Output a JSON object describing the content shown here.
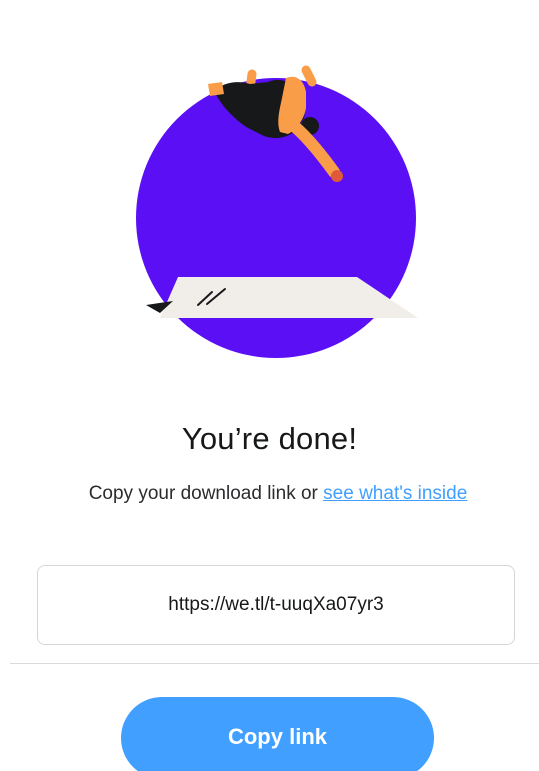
{
  "illustration": {
    "name": "person-jumping-illustration",
    "colors": {
      "circle": "#5b0ff5",
      "skin": "#fa9d48",
      "clothing": "#17181a",
      "paper": "#f1ede8",
      "pen": "#17181a"
    }
  },
  "heading": {
    "title": "You’re done!"
  },
  "description": {
    "text_before_link": "Copy your download link or ",
    "link_text": "see what's inside"
  },
  "link_field": {
    "value": "https://we.tl/t-uuqXa07yr3"
  },
  "actions": {
    "copy_label": "Copy link"
  },
  "colors": {
    "accent": "#409fff",
    "title_text": "#17181a",
    "border": "#d4d7d9"
  }
}
